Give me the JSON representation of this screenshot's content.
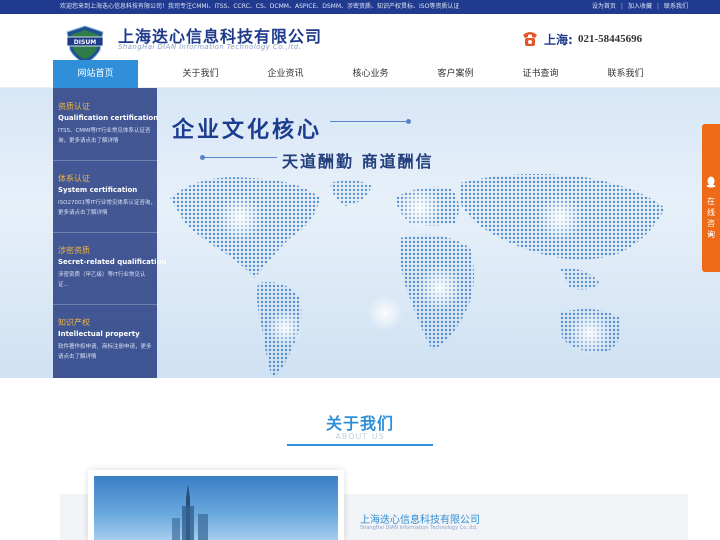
{
  "topbar": {
    "welcome": "欢迎您来到上海迭心信息科技有限公司！我司专注CMMI、ITSS、CCRC、CS、DCMM、ASPICE、DSMM、涉密资质、知识产权贯标、ISO等资质认证",
    "links": [
      "设为首页",
      "加入收藏",
      "联系我们"
    ]
  },
  "header": {
    "logo_text": "DISUM",
    "brand_cn": "上海迭心信息科技有限公司",
    "brand_en": "ShangHai DIAN Information Technology Co.,ltd.",
    "phone_label": "上海:",
    "phone_number": "021-58445696"
  },
  "nav": {
    "items": [
      "网站首页",
      "关于我们",
      "企业资讯",
      "核心业务",
      "客户案例",
      "证书查询",
      "联系我们"
    ],
    "active_index": 0
  },
  "banner": {
    "title": "企业文化核心",
    "subtitle": "天道酬勤 商道酬信"
  },
  "sidepanel": {
    "blocks": [
      {
        "cn": "资质认证",
        "en": "Qualification certification",
        "desc": "ITSS、CMMI等IT行业常见体系认证咨询，更多请点击了解详情"
      },
      {
        "cn": "体系认证",
        "en": "System certification",
        "desc": "ISO27001等IT行业常见体系认证咨询，更多请点击了解详情"
      },
      {
        "cn": "涉密资质",
        "en": "Secret-related qualification",
        "desc": "涉密资质（甲乙级）等IT行业常见认证..."
      },
      {
        "cn": "知识产权",
        "en": "Intellectual property",
        "desc": "软件著作权申请、商标注册申请，更多请点击了解详情"
      }
    ]
  },
  "float_tab": {
    "label": "在线咨询",
    "arrow": "«"
  },
  "about": {
    "title": "关于我们",
    "subtitle": "ABOUT US",
    "company_cn": "上海迭心信息科技有限公司",
    "company_en": "ShangHai DIAN Information Technology Co.,ltd."
  },
  "colors": {
    "primary": "#1e3a8a",
    "accent": "#2f8fd8",
    "highlight": "#f1b53a",
    "consult": "#ee6a16"
  }
}
